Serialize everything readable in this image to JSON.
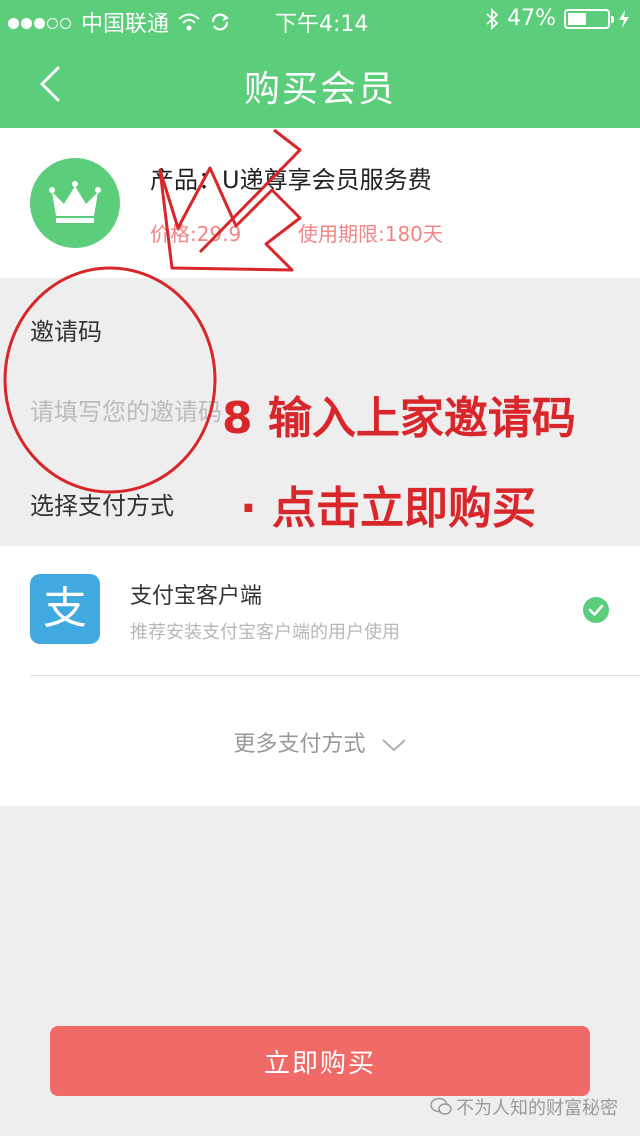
{
  "status_bar": {
    "carrier": "中国联通",
    "time": "下午4:14",
    "battery": "47%",
    "battery_level": 0.47
  },
  "nav": {
    "title": "购买会员"
  },
  "product": {
    "name": "产品：U递尊享会员服务费",
    "price": "价格:29.9",
    "period": "使用期限:180天"
  },
  "invite": {
    "label": "邀请码",
    "placeholder": "请填写您的邀请码"
  },
  "payment": {
    "label": "选择支付方式",
    "method": {
      "title": "支付宝客户端",
      "subtitle": "推荐安装支付宝客户端的用户使用",
      "icon_glyph": "支",
      "selected": true
    },
    "more": "更多支付方式"
  },
  "buy_button": "立即购买",
  "annotations": {
    "step1": "8  输入上家邀请码",
    "step2": "· 点击立即购买"
  },
  "watermark": "不为人知的财富秘密",
  "colors": {
    "primary_green": "#5ccd7b",
    "buy_red": "#f06b68",
    "alipay_blue": "#3fa9e0",
    "annotation_red": "#d8262a"
  }
}
